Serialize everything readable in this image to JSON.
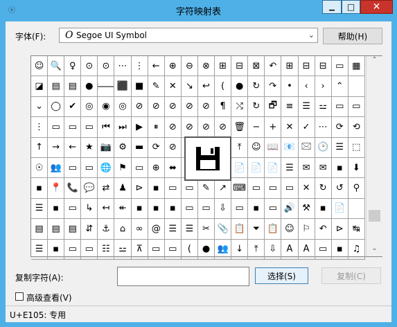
{
  "window": {
    "title": "字符映射表",
    "close_glyph": "✕",
    "min_glyph": "▁",
    "max_glyph": "□"
  },
  "font_row": {
    "label": "字体(F):",
    "selected_font": "Segoe UI Symbol",
    "font_icon": "O",
    "help_button": "帮助(H)"
  },
  "grid": {
    "cells": [
      "☺",
      "🔍",
      "♀",
      "⊙",
      "⊙",
      "⋯",
      "⋮",
      "←",
      "⊕",
      "⊖",
      "⊗",
      "⊞",
      "⊟",
      "⊠",
      "↶",
      "⊞",
      "⊟",
      "⊟",
      "▭",
      "▦",
      "◪",
      "▤",
      "▤",
      "●",
      "🡐",
      "⬛",
      "■",
      "✎",
      "✕",
      "↘",
      "↩",
      "(",
      "●",
      "↻",
      "↷",
      "•",
      "‹",
      "›",
      "⌃",
      "",
      "⌄",
      "◯",
      "✔",
      "◎",
      "◉",
      "◎",
      "⊘",
      "⊘",
      "⊘",
      "⊘",
      "⊘",
      "¶",
      "⤭",
      "↻",
      "🗗",
      "≡",
      "☰",
      "⚍",
      "▭",
      "▭",
      "⋮",
      "▭",
      "▭",
      "▭",
      "⏮",
      "⏭",
      "▶",
      "⏸",
      "⊘",
      "⊘",
      "⊘",
      "⊘",
      "🗑",
      "−",
      "+",
      "✕",
      "✓",
      "⋯",
      "⟳",
      "⟲",
      "↑",
      "→",
      "←",
      "★",
      "📷",
      "⚙",
      "▬",
      "⟳",
      "⊘",
      "⊘",
      "⊘",
      "?",
      "⤒",
      "☺",
      "📖",
      "📧",
      "🖂",
      "🕑",
      "☰",
      "⬚",
      "☉",
      "👥",
      "▭",
      "▭",
      "🌐",
      "⚑",
      "▭",
      "⊕",
      "⬌",
      "📷",
      "🔍",
      "☰",
      "📄",
      "📄",
      "📄",
      "☰",
      "✉",
      "✉",
      "▪",
      "⬇",
      "▪",
      "📍",
      "📞",
      "💬",
      "⇄",
      "♟",
      "⊳",
      "▪",
      "▭",
      "▭",
      "✎",
      "↗",
      "⌨",
      "▭",
      "▭",
      "▭",
      "✕",
      "↻",
      "↺",
      "⚲",
      "☰",
      "▪",
      "▭",
      "↳",
      "↤",
      "↞",
      "▪",
      "▪",
      "▪",
      "▭",
      "▭",
      "⇩",
      "▭",
      "▪",
      "▭",
      "🔊",
      "⚒",
      "▪",
      "📄",
      "",
      "▤",
      "▤",
      "▤",
      "⇵",
      "⚓",
      "⌂",
      "∞",
      "@",
      "☰",
      "☰",
      "✂",
      "📎",
      "📋",
      "⏷",
      "📋",
      "☺",
      "⚐",
      "↶",
      "⊳",
      "↹",
      "☰",
      "▪",
      "▭",
      "▭",
      "☷",
      "⚍",
      "⊼",
      "▭",
      "▭",
      "(",
      "●",
      "👥",
      "↓",
      "⤒",
      "⇩",
      "A",
      "A",
      "▭",
      "▪",
      "♫"
    ],
    "zoom_icon": "save-icon"
  },
  "copy_row": {
    "label": "复制字符(A):",
    "value": "",
    "select_button": "选择(S)",
    "copy_button": "复制(C)"
  },
  "advanced": {
    "label": "高级查看(V)",
    "checked": false
  },
  "status": {
    "text": "U+E105: 专用"
  },
  "colors": {
    "title_bar": "#4fb0e8",
    "close_button": "#c8332b",
    "client_bg": "#f0f0f0"
  }
}
